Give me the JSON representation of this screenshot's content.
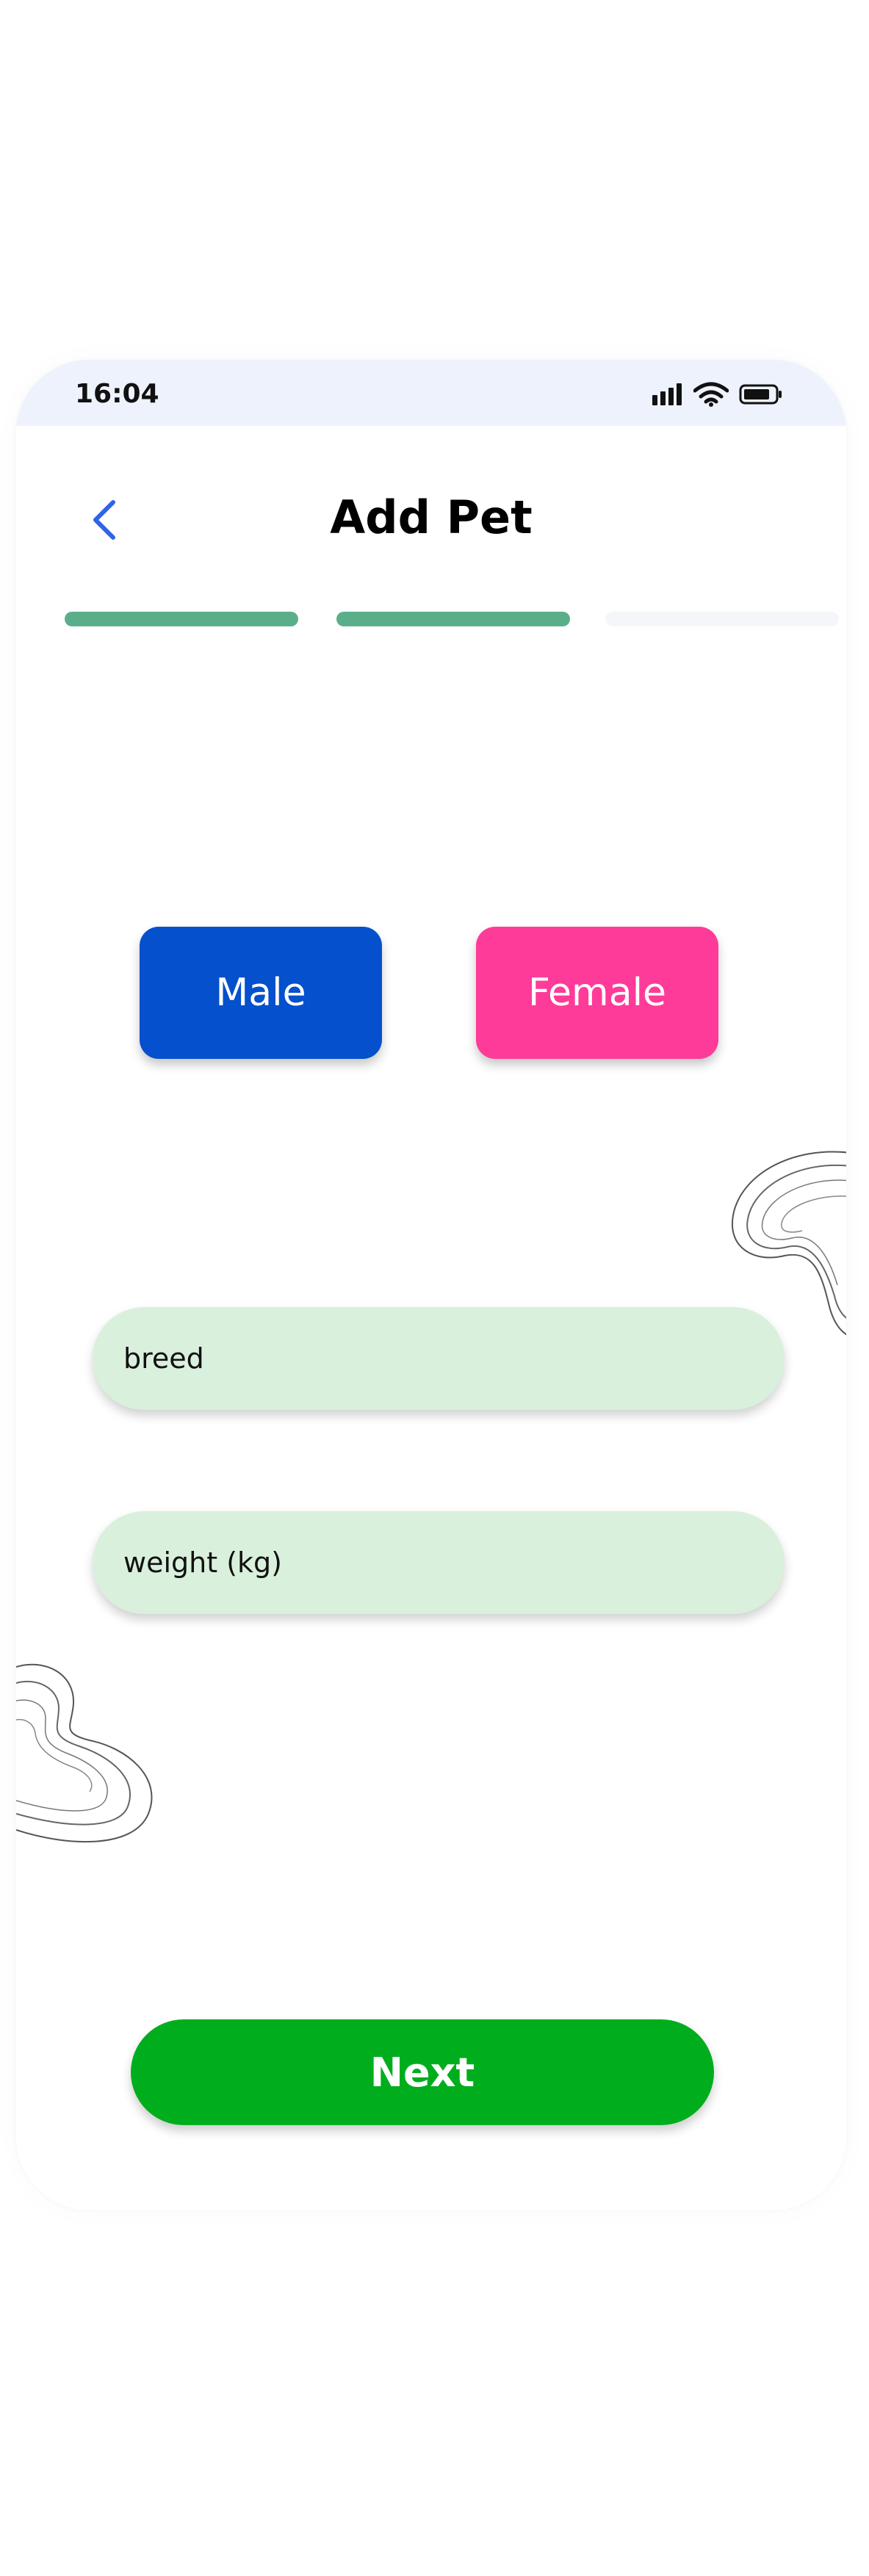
{
  "status_bar": {
    "time": "16:04",
    "icons": [
      "signal-icon",
      "wifi-icon",
      "battery-icon"
    ]
  },
  "header": {
    "title": "Add Pet",
    "back_icon": "chevron-left-icon"
  },
  "progress": {
    "total_steps": 3,
    "completed_steps": 2,
    "active_color": "#5aaf8a",
    "inactive_color": "#f5f6f9"
  },
  "gender": {
    "male_label": "Male",
    "female_label": "Female",
    "male_color": "#0550cd",
    "female_color": "#ff3b99"
  },
  "form": {
    "breed_placeholder": "breed",
    "weight_placeholder": "weight (kg)",
    "field_color": "#d9f0dd"
  },
  "actions": {
    "next_label": "Next",
    "next_color": "#00ae1d"
  },
  "colors": {
    "accent_blue": "#2f64e6",
    "status_bar_bg": "#edf2fc"
  }
}
